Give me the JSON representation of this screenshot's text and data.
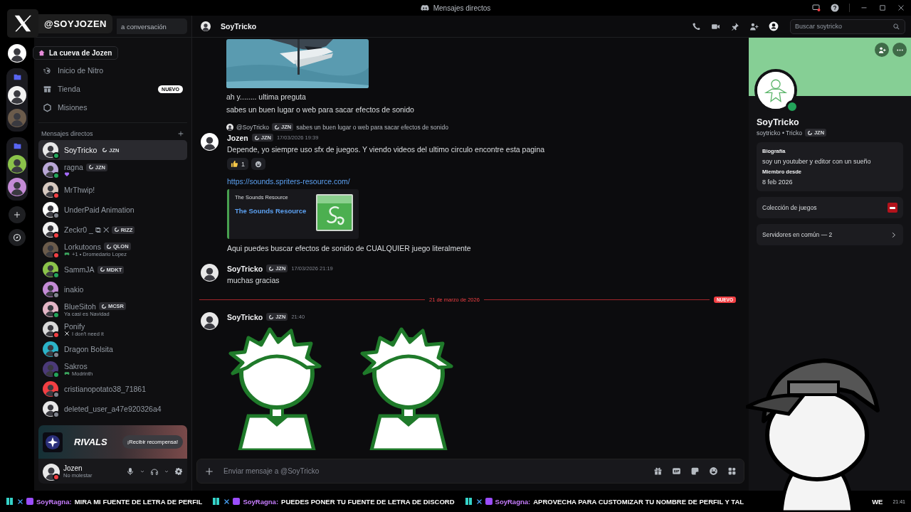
{
  "window": {
    "title": "Mensajes directos"
  },
  "overlay": {
    "handle": "@SOYJOZEN",
    "tooltip": "La cueva de Jozen"
  },
  "rail": [
    {
      "kind": "server"
    },
    {
      "kind": "folder",
      "children": [
        {
          "kind": "server"
        },
        {
          "kind": "server"
        }
      ]
    },
    {
      "kind": "folder",
      "children": [
        {
          "kind": "server"
        },
        {
          "kind": "server"
        }
      ]
    },
    {
      "kind": "add"
    },
    {
      "kind": "discover"
    }
  ],
  "search": {
    "placeholder": "a conversación"
  },
  "nav": [
    {
      "label": "Inicio de Nitro",
      "kind": "nitro"
    },
    {
      "label": "Tienda",
      "kind": "shop",
      "badge": "NUEVO"
    },
    {
      "label": "Misiones",
      "kind": "quests"
    }
  ],
  "dm_header": {
    "title": "Mensajes directos"
  },
  "dms": [
    {
      "name": "SoyTricko",
      "tag": "JZN",
      "color": "#23a55a",
      "selected": true
    },
    {
      "name": "ragna",
      "tag": "JZN",
      "activity": {
        "kind": "heart"
      },
      "color": "#23a55a",
      "selected": false
    },
    {
      "name": "MrThwip!",
      "color": "#f23f43",
      "selected": false
    },
    {
      "name": "UnderPaid Animation",
      "color": "#80848e",
      "selected": false
    },
    {
      "name": "Zeckr0 _ ⧉ ✕",
      "tag": "RIZZ",
      "color": "#f23f43",
      "selected": false
    },
    {
      "name": "Lorkutoons",
      "tag": "QLON",
      "activity": {
        "kind": "game",
        "text": "+1 • Dromedario Lopez"
      },
      "color": "#f23f43",
      "selected": false
    },
    {
      "name": "SammJA",
      "tag": "MDKT",
      "color": "#23a55a",
      "selected": false
    },
    {
      "name": "inakio",
      "color": "#80848e",
      "selected": false
    },
    {
      "name": "BlueSitoh",
      "tag": "MCSR",
      "activity": {
        "kind": "status",
        "text": "Ya casi es Navidad"
      },
      "color": "#23a55a",
      "selected": false
    },
    {
      "name": "Ponify",
      "activity": {
        "kind": "swords",
        "text": "I don't need it"
      },
      "color": "#f23f43",
      "selected": false
    },
    {
      "name": "Dragon Bolsita",
      "color": "#80848e",
      "selected": false
    },
    {
      "name": "Sakros",
      "activity": {
        "kind": "game",
        "text": "Modrinth"
      },
      "color": "#23a55a",
      "selected": false
    },
    {
      "name": "cristianopotato38_71861",
      "color": "#80848e",
      "selected": false
    },
    {
      "name": "deleted_user_a47e920326a4",
      "color": "#80848e",
      "selected": false
    }
  ],
  "promo": {
    "logo": "RIVALS",
    "button": "¡Recibir recompensa!"
  },
  "user": {
    "name": "Jozen",
    "status_text": "No molestar",
    "color": "#f23f43"
  },
  "chat": {
    "recipient": "SoyTricko",
    "search_placeholder": "Buscar soytricko",
    "messages": [
      {
        "kind": "attachment",
        "lines": [
          "ah y........ ultima preguta",
          "sabes un buen lugar o web para sacar efectos de sonido"
        ]
      },
      {
        "kind": "message",
        "author": "Jozen",
        "tag": "JZN",
        "time": "17/03/2026 19:39",
        "reply": {
          "author": "@SoyTricko",
          "tag": "JZN",
          "text": "sabes un buen lugar o web para sacar efectos de sonido"
        },
        "text": "Depende, yo siempre uso sfx de juegos. Y viendo videos del ultimo circulo encontre esta pagina",
        "reactions": [
          {
            "count": "1"
          }
        ],
        "link": "https://sounds.spriters-resource.com/",
        "embed": {
          "provider": "The Sounds Resource",
          "title": "The Sounds Resource"
        },
        "after": "Aqui puedes buscar efectos de sonido de CUALQUIER juego literalmente"
      },
      {
        "kind": "message",
        "author": "SoyTricko",
        "tag": "JZN",
        "time": "17/03/2026 21:19",
        "text": "muchas gracias"
      },
      {
        "kind": "divider",
        "label": "21 de marzo de 2026",
        "badge": "NUEVO"
      },
      {
        "kind": "message",
        "author": "SoyTricko",
        "tag": "JZN",
        "time": "21:40",
        "stickers": [
          {
            "kind": "sticker"
          },
          {
            "kind": "sticker"
          }
        ]
      }
    ],
    "composer_placeholder": "Enviar mensaje a @SoyTricko"
  },
  "profile": {
    "display_name": "SoyTricko",
    "username": "soytricko • Tricko",
    "tag": "JZN",
    "color": "#23a55a",
    "bio_label": "Biografía",
    "bio": "soy un youtuber y editor con un sueño",
    "member_label": "Miembro desde",
    "member_since": "8 feb 2026",
    "games": "Colección de juegos",
    "mutual": "Servidores en común — 2"
  },
  "ticker": [
    {
      "user": "SoyRagna:",
      "text": "MIRA MI FUENTE DE LETRA DE PERFIL"
    },
    {
      "user": "SoyRagna:",
      "text": "PUEDES PONER TU FUENTE DE LETRA DE DISCORD"
    },
    {
      "user": "SoyRagna:",
      "text": "APROVECHA PARA CUSTOMIZAR TU NOMBRE DE PERFIL Y TAL"
    }
  ],
  "ticker_tail": "WE",
  "clock": "21:41"
}
